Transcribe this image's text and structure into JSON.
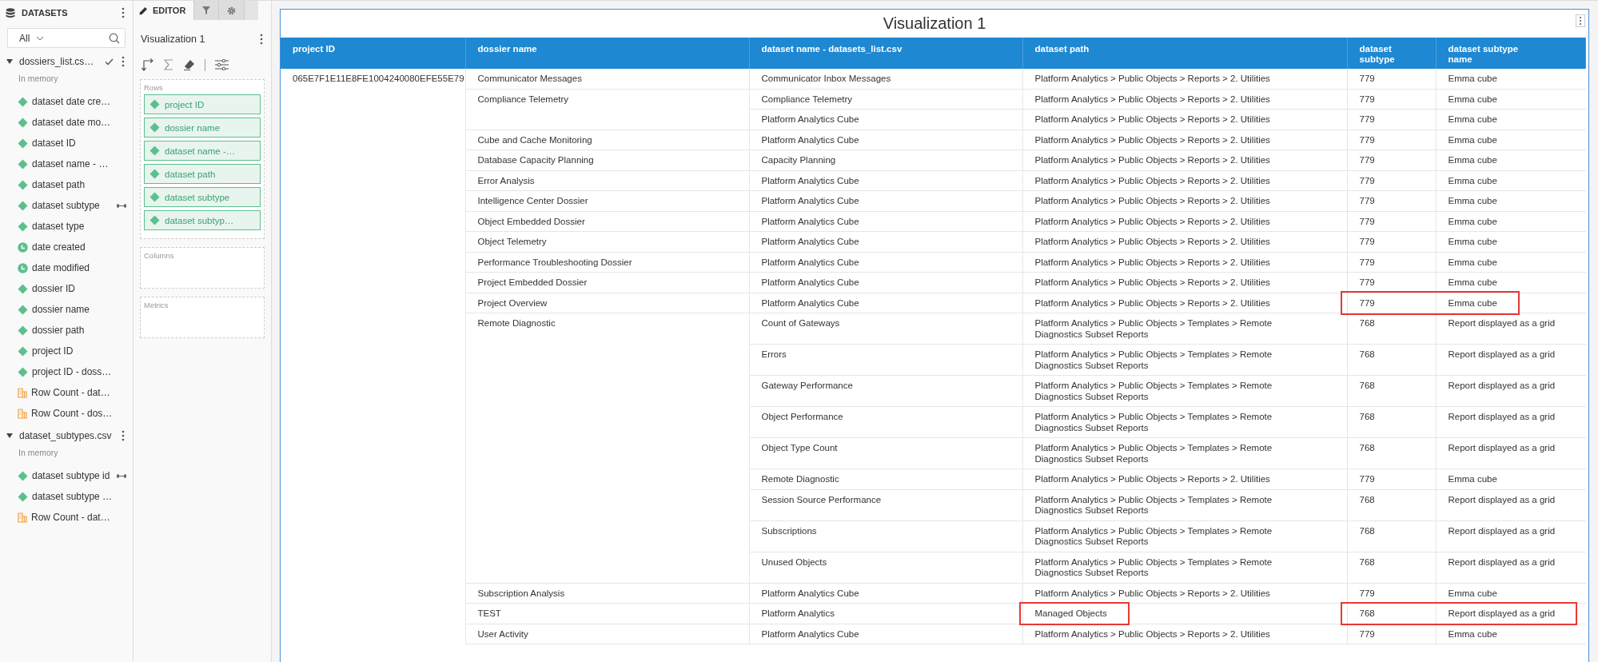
{
  "datasets_panel": {
    "title": "DATASETS",
    "filter": {
      "value": "All"
    },
    "datasets": [
      {
        "name": "dossiers_list.cs…",
        "expanded": true,
        "checked": true,
        "source": "In memory",
        "items": [
          {
            "label": "dataset date cre…",
            "kind": "attribute",
            "linked": false
          },
          {
            "label": "dataset date mo…",
            "kind": "attribute",
            "linked": false
          },
          {
            "label": "dataset ID",
            "kind": "attribute",
            "linked": false
          },
          {
            "label": "dataset name - …",
            "kind": "attribute",
            "linked": false
          },
          {
            "label": "dataset path",
            "kind": "attribute",
            "linked": false
          },
          {
            "label": "dataset subtype",
            "kind": "attribute",
            "linked": true
          },
          {
            "label": "dataset type",
            "kind": "attribute",
            "linked": false
          },
          {
            "label": "date created",
            "kind": "date",
            "linked": false
          },
          {
            "label": "date modified",
            "kind": "date",
            "linked": false
          },
          {
            "label": "dossier ID",
            "kind": "attribute",
            "linked": false
          },
          {
            "label": "dossier name",
            "kind": "attribute",
            "linked": false
          },
          {
            "label": "dossier path",
            "kind": "attribute",
            "linked": false
          },
          {
            "label": "project ID",
            "kind": "attribute",
            "linked": false
          },
          {
            "label": "project ID - doss…",
            "kind": "attribute",
            "linked": false
          },
          {
            "label": "Row Count - dat…",
            "kind": "metric",
            "linked": false
          },
          {
            "label": "Row Count - dos…",
            "kind": "metric",
            "linked": false
          }
        ]
      },
      {
        "name": "dataset_subtypes.csv",
        "expanded": true,
        "checked": false,
        "source": "In memory",
        "items": [
          {
            "label": "dataset subtype id",
            "kind": "attribute",
            "linked": true
          },
          {
            "label": "dataset subtype …",
            "kind": "attribute",
            "linked": false
          },
          {
            "label": "Row Count - dat…",
            "kind": "metric",
            "linked": false
          }
        ]
      }
    ]
  },
  "editor_panel": {
    "tabs": [
      {
        "kind": "editor",
        "label": "EDITOR",
        "selected": true
      },
      {
        "kind": "filter",
        "selected": false
      },
      {
        "kind": "format",
        "selected": false
      }
    ],
    "visualization_name": "Visualization 1",
    "drop_zones": [
      {
        "title": "Rows",
        "items": [
          "project ID",
          "dossier name",
          "dataset name -…",
          "dataset path",
          "dataset subtype",
          "dataset subtyp…"
        ]
      },
      {
        "title": "Columns"
      },
      {
        "title": "Metrics"
      }
    ]
  },
  "visualization": {
    "title": "Visualization 1",
    "columns": [
      "project ID",
      "dossier name",
      "dataset name - datasets_list.csv",
      "dataset path",
      "dataset subtype",
      "dataset subtype name"
    ],
    "project_groups": [
      {
        "project_id": "065E7F1E11E8FE1004240080EFE55E79",
        "dossiers": [
          {
            "name": "Communicator Messages",
            "datasets": [
              {
                "name": "Communicator Inbox Messages",
                "path": "Platform Analytics > Public Objects > Reports > 2. Utilities",
                "subtype": "779",
                "subtype_name": "Emma cube",
                "path_marked": false,
                "subtype_marked": false
              }
            ]
          },
          {
            "name": "Compliance Telemetry",
            "datasets": [
              {
                "name": "Compliance Telemetry",
                "path": "Platform Analytics > Public Objects > Reports > 2. Utilities",
                "subtype": "779",
                "subtype_name": "Emma cube",
                "path_marked": false,
                "subtype_marked": false
              },
              {
                "name": "Platform Analytics Cube",
                "path": "Platform Analytics > Public Objects > Reports > 2. Utilities",
                "subtype": "779",
                "subtype_name": "Emma cube",
                "path_marked": false,
                "subtype_marked": false
              }
            ]
          },
          {
            "name": "Cube and Cache Monitoring",
            "datasets": [
              {
                "name": "Platform Analytics Cube",
                "path": "Platform Analytics > Public Objects > Reports > 2. Utilities",
                "subtype": "779",
                "subtype_name": "Emma cube",
                "path_marked": false,
                "subtype_marked": false
              }
            ]
          },
          {
            "name": "Database Capacity Planning",
            "datasets": [
              {
                "name": "Capacity Planning",
                "path": "Platform Analytics > Public Objects > Reports > 2. Utilities",
                "subtype": "779",
                "subtype_name": "Emma cube",
                "path_marked": false,
                "subtype_marked": false
              }
            ]
          },
          {
            "name": "Error Analysis",
            "datasets": [
              {
                "name": "Platform Analytics Cube",
                "path": "Platform Analytics > Public Objects > Reports > 2. Utilities",
                "subtype": "779",
                "subtype_name": "Emma cube",
                "path_marked": false,
                "subtype_marked": false
              }
            ]
          },
          {
            "name": "Intelligence Center Dossier",
            "datasets": [
              {
                "name": "Platform Analytics Cube",
                "path": "Platform Analytics > Public Objects > Reports > 2. Utilities",
                "subtype": "779",
                "subtype_name": "Emma cube",
                "path_marked": false,
                "subtype_marked": false
              }
            ]
          },
          {
            "name": "Object Embedded Dossier",
            "datasets": [
              {
                "name": "Platform Analytics Cube",
                "path": "Platform Analytics > Public Objects > Reports > 2. Utilities",
                "subtype": "779",
                "subtype_name": "Emma cube",
                "path_marked": false,
                "subtype_marked": false
              }
            ]
          },
          {
            "name": "Object Telemetry",
            "datasets": [
              {
                "name": "Platform Analytics Cube",
                "path": "Platform Analytics > Public Objects > Reports > 2. Utilities",
                "subtype": "779",
                "subtype_name": "Emma cube",
                "path_marked": false,
                "subtype_marked": false
              }
            ]
          },
          {
            "name": "Performance Troubleshooting Dossier",
            "datasets": [
              {
                "name": "Platform Analytics Cube",
                "path": "Platform Analytics > Public Objects > Reports > 2. Utilities",
                "subtype": "779",
                "subtype_name": "Emma cube",
                "path_marked": false,
                "subtype_marked": false
              }
            ]
          },
          {
            "name": "Project Embedded Dossier",
            "datasets": [
              {
                "name": "Platform Analytics Cube",
                "path": "Platform Analytics > Public Objects > Reports > 2. Utilities",
                "subtype": "779",
                "subtype_name": "Emma cube",
                "path_marked": false,
                "subtype_marked": false
              }
            ]
          },
          {
            "name": "Project Overview",
            "datasets": [
              {
                "name": "Platform Analytics Cube",
                "path": "Platform Analytics > Public Objects > Reports > 2. Utilities",
                "subtype": "779",
                "subtype_name": "Emma cube",
                "path_marked": false,
                "subtype_marked": true
              }
            ]
          },
          {
            "name": "Remote Diagnostic",
            "datasets": [
              {
                "name": "Count of Gateways",
                "path": "Platform Analytics > Public Objects > Templates > Remote Diagnostics Subset Reports",
                "subtype": "768",
                "subtype_name": "Report displayed as a grid",
                "path_marked": false,
                "subtype_marked": false
              },
              {
                "name": "Errors",
                "path": "Platform Analytics > Public Objects > Templates > Remote Diagnostics Subset Reports",
                "subtype": "768",
                "subtype_name": "Report displayed as a grid",
                "path_marked": false,
                "subtype_marked": false
              },
              {
                "name": "Gateway Performance",
                "path": "Platform Analytics > Public Objects > Templates > Remote Diagnostics Subset Reports",
                "subtype": "768",
                "subtype_name": "Report displayed as a grid",
                "path_marked": false,
                "subtype_marked": false
              },
              {
                "name": "Object Performance",
                "path": "Platform Analytics > Public Objects > Templates > Remote Diagnostics Subset Reports",
                "subtype": "768",
                "subtype_name": "Report displayed as a grid",
                "path_marked": false,
                "subtype_marked": false
              },
              {
                "name": "Object Type Count",
                "path": "Platform Analytics > Public Objects > Templates > Remote Diagnostics Subset Reports",
                "subtype": "768",
                "subtype_name": "Report displayed as a grid",
                "path_marked": false,
                "subtype_marked": false
              },
              {
                "name": "Remote Diagnostic",
                "path": "Platform Analytics > Public Objects > Reports > 2. Utilities",
                "subtype": "779",
                "subtype_name": "Emma cube",
                "path_marked": false,
                "subtype_marked": false
              },
              {
                "name": "Session Source Performance",
                "path": "Platform Analytics > Public Objects > Templates > Remote Diagnostics Subset Reports",
                "subtype": "768",
                "subtype_name": "Report displayed as a grid",
                "path_marked": false,
                "subtype_marked": false
              },
              {
                "name": "Subscriptions",
                "path": "Platform Analytics > Public Objects > Templates > Remote Diagnostics Subset Reports",
                "subtype": "768",
                "subtype_name": "Report displayed as a grid",
                "path_marked": false,
                "subtype_marked": false
              },
              {
                "name": "Unused Objects",
                "path": "Platform Analytics > Public Objects > Templates > Remote Diagnostics Subset Reports",
                "subtype": "768",
                "subtype_name": "Report displayed as a grid",
                "path_marked": false,
                "subtype_marked": false
              }
            ]
          },
          {
            "name": "Subscription Analysis",
            "datasets": [
              {
                "name": "Platform Analytics Cube",
                "path": "Platform Analytics > Public Objects > Reports > 2. Utilities",
                "subtype": "779",
                "subtype_name": "Emma cube",
                "path_marked": false,
                "subtype_marked": false
              }
            ]
          },
          {
            "name": "TEST",
            "datasets": [
              {
                "name": "Platform Analytics",
                "path": "Managed Objects",
                "subtype": "768",
                "subtype_name": "Report displayed as a grid",
                "path_marked": true,
                "subtype_marked": true
              }
            ]
          },
          {
            "name": "User Activity",
            "datasets": [
              {
                "name": "Platform Analytics Cube",
                "path": "Platform Analytics > Public Objects > Reports > 2. Utilities",
                "subtype": "779",
                "subtype_name": "Emma cube",
                "path_marked": false,
                "subtype_marked": false
              }
            ]
          }
        ]
      }
    ]
  }
}
